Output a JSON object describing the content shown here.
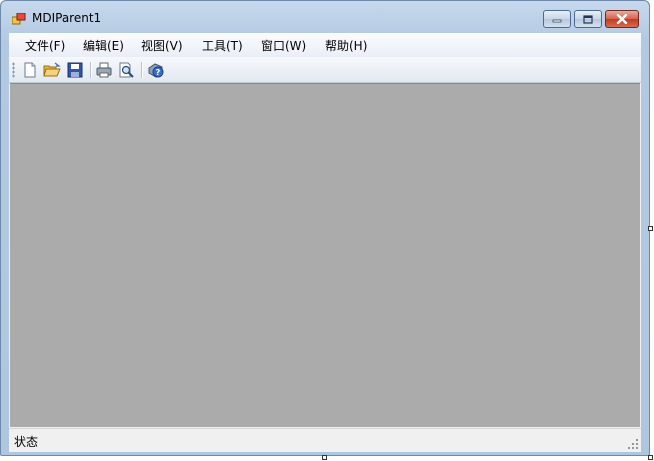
{
  "window": {
    "title": "MDIParent1",
    "app_icon": "mdi-windows-icon",
    "controls": [
      "minimize-icon",
      "maximize-icon",
      "close-icon"
    ]
  },
  "menu": {
    "items": [
      {
        "label": "文件(F)"
      },
      {
        "label": "编辑(E)"
      },
      {
        "label": "视图(V)"
      },
      {
        "label": "工具(T)"
      },
      {
        "label": "窗口(W)"
      },
      {
        "label": "帮助(H)"
      }
    ]
  },
  "toolbar": {
    "buttons": [
      "new-file-icon",
      "open-folder-icon",
      "save-icon",
      "print-icon",
      "print-preview-icon",
      "help-icon"
    ]
  },
  "status": {
    "label": "状态"
  },
  "colors": {
    "mdi_background": "#ababab",
    "title_gradient": "#c6d8ec",
    "close_button": "#c13b22"
  }
}
